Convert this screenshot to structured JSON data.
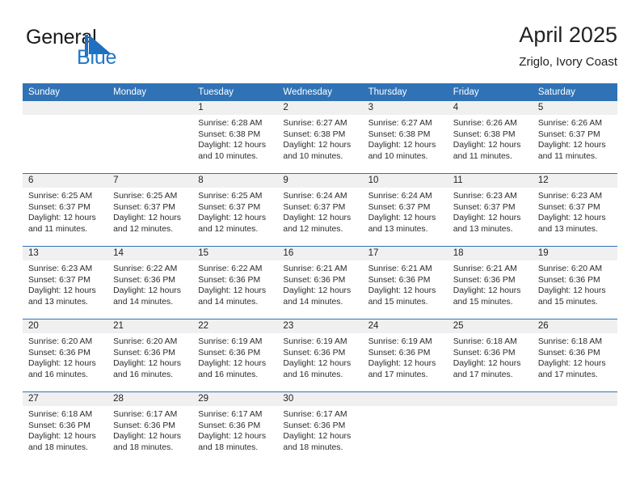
{
  "brand": {
    "name_top": "General",
    "name_bottom": "Blue",
    "flag_icon": "triangle-flag-icon",
    "color_top": "#1a1a1a",
    "color_bottom": "#2277c8"
  },
  "header": {
    "title": "April 2025",
    "subtitle": "Zriglo, Ivory Coast"
  },
  "theme": {
    "header_blue": "#3072b6",
    "daynum_band": "#f0f0f0",
    "text": "#222222"
  },
  "weekdays": [
    "Sunday",
    "Monday",
    "Tuesday",
    "Wednesday",
    "Thursday",
    "Friday",
    "Saturday"
  ],
  "labels": {
    "sunrise_prefix": "Sunrise: ",
    "sunset_prefix": "Sunset: ",
    "daylight_prefix": "Daylight: "
  },
  "weeks": [
    [
      {
        "day": "",
        "empty": true
      },
      {
        "day": "",
        "empty": true
      },
      {
        "day": "1",
        "sunrise": "Sunrise: 6:28 AM",
        "sunset": "Sunset: 6:38 PM",
        "daylight_l1": "Daylight: 12 hours",
        "daylight_l2": "and 10 minutes."
      },
      {
        "day": "2",
        "sunrise": "Sunrise: 6:27 AM",
        "sunset": "Sunset: 6:38 PM",
        "daylight_l1": "Daylight: 12 hours",
        "daylight_l2": "and 10 minutes."
      },
      {
        "day": "3",
        "sunrise": "Sunrise: 6:27 AM",
        "sunset": "Sunset: 6:38 PM",
        "daylight_l1": "Daylight: 12 hours",
        "daylight_l2": "and 10 minutes."
      },
      {
        "day": "4",
        "sunrise": "Sunrise: 6:26 AM",
        "sunset": "Sunset: 6:38 PM",
        "daylight_l1": "Daylight: 12 hours",
        "daylight_l2": "and 11 minutes."
      },
      {
        "day": "5",
        "sunrise": "Sunrise: 6:26 AM",
        "sunset": "Sunset: 6:37 PM",
        "daylight_l1": "Daylight: 12 hours",
        "daylight_l2": "and 11 minutes."
      }
    ],
    [
      {
        "day": "6",
        "sunrise": "Sunrise: 6:25 AM",
        "sunset": "Sunset: 6:37 PM",
        "daylight_l1": "Daylight: 12 hours",
        "daylight_l2": "and 11 minutes."
      },
      {
        "day": "7",
        "sunrise": "Sunrise: 6:25 AM",
        "sunset": "Sunset: 6:37 PM",
        "daylight_l1": "Daylight: 12 hours",
        "daylight_l2": "and 12 minutes."
      },
      {
        "day": "8",
        "sunrise": "Sunrise: 6:25 AM",
        "sunset": "Sunset: 6:37 PM",
        "daylight_l1": "Daylight: 12 hours",
        "daylight_l2": "and 12 minutes."
      },
      {
        "day": "9",
        "sunrise": "Sunrise: 6:24 AM",
        "sunset": "Sunset: 6:37 PM",
        "daylight_l1": "Daylight: 12 hours",
        "daylight_l2": "and 12 minutes."
      },
      {
        "day": "10",
        "sunrise": "Sunrise: 6:24 AM",
        "sunset": "Sunset: 6:37 PM",
        "daylight_l1": "Daylight: 12 hours",
        "daylight_l2": "and 13 minutes."
      },
      {
        "day": "11",
        "sunrise": "Sunrise: 6:23 AM",
        "sunset": "Sunset: 6:37 PM",
        "daylight_l1": "Daylight: 12 hours",
        "daylight_l2": "and 13 minutes."
      },
      {
        "day": "12",
        "sunrise": "Sunrise: 6:23 AM",
        "sunset": "Sunset: 6:37 PM",
        "daylight_l1": "Daylight: 12 hours",
        "daylight_l2": "and 13 minutes."
      }
    ],
    [
      {
        "day": "13",
        "sunrise": "Sunrise: 6:23 AM",
        "sunset": "Sunset: 6:37 PM",
        "daylight_l1": "Daylight: 12 hours",
        "daylight_l2": "and 13 minutes."
      },
      {
        "day": "14",
        "sunrise": "Sunrise: 6:22 AM",
        "sunset": "Sunset: 6:36 PM",
        "daylight_l1": "Daylight: 12 hours",
        "daylight_l2": "and 14 minutes."
      },
      {
        "day": "15",
        "sunrise": "Sunrise: 6:22 AM",
        "sunset": "Sunset: 6:36 PM",
        "daylight_l1": "Daylight: 12 hours",
        "daylight_l2": "and 14 minutes."
      },
      {
        "day": "16",
        "sunrise": "Sunrise: 6:21 AM",
        "sunset": "Sunset: 6:36 PM",
        "daylight_l1": "Daylight: 12 hours",
        "daylight_l2": "and 14 minutes."
      },
      {
        "day": "17",
        "sunrise": "Sunrise: 6:21 AM",
        "sunset": "Sunset: 6:36 PM",
        "daylight_l1": "Daylight: 12 hours",
        "daylight_l2": "and 15 minutes."
      },
      {
        "day": "18",
        "sunrise": "Sunrise: 6:21 AM",
        "sunset": "Sunset: 6:36 PM",
        "daylight_l1": "Daylight: 12 hours",
        "daylight_l2": "and 15 minutes."
      },
      {
        "day": "19",
        "sunrise": "Sunrise: 6:20 AM",
        "sunset": "Sunset: 6:36 PM",
        "daylight_l1": "Daylight: 12 hours",
        "daylight_l2": "and 15 minutes."
      }
    ],
    [
      {
        "day": "20",
        "sunrise": "Sunrise: 6:20 AM",
        "sunset": "Sunset: 6:36 PM",
        "daylight_l1": "Daylight: 12 hours",
        "daylight_l2": "and 16 minutes."
      },
      {
        "day": "21",
        "sunrise": "Sunrise: 6:20 AM",
        "sunset": "Sunset: 6:36 PM",
        "daylight_l1": "Daylight: 12 hours",
        "daylight_l2": "and 16 minutes."
      },
      {
        "day": "22",
        "sunrise": "Sunrise: 6:19 AM",
        "sunset": "Sunset: 6:36 PM",
        "daylight_l1": "Daylight: 12 hours",
        "daylight_l2": "and 16 minutes."
      },
      {
        "day": "23",
        "sunrise": "Sunrise: 6:19 AM",
        "sunset": "Sunset: 6:36 PM",
        "daylight_l1": "Daylight: 12 hours",
        "daylight_l2": "and 16 minutes."
      },
      {
        "day": "24",
        "sunrise": "Sunrise: 6:19 AM",
        "sunset": "Sunset: 6:36 PM",
        "daylight_l1": "Daylight: 12 hours",
        "daylight_l2": "and 17 minutes."
      },
      {
        "day": "25",
        "sunrise": "Sunrise: 6:18 AM",
        "sunset": "Sunset: 6:36 PM",
        "daylight_l1": "Daylight: 12 hours",
        "daylight_l2": "and 17 minutes."
      },
      {
        "day": "26",
        "sunrise": "Sunrise: 6:18 AM",
        "sunset": "Sunset: 6:36 PM",
        "daylight_l1": "Daylight: 12 hours",
        "daylight_l2": "and 17 minutes."
      }
    ],
    [
      {
        "day": "27",
        "sunrise": "Sunrise: 6:18 AM",
        "sunset": "Sunset: 6:36 PM",
        "daylight_l1": "Daylight: 12 hours",
        "daylight_l2": "and 18 minutes."
      },
      {
        "day": "28",
        "sunrise": "Sunrise: 6:17 AM",
        "sunset": "Sunset: 6:36 PM",
        "daylight_l1": "Daylight: 12 hours",
        "daylight_l2": "and 18 minutes."
      },
      {
        "day": "29",
        "sunrise": "Sunrise: 6:17 AM",
        "sunset": "Sunset: 6:36 PM",
        "daylight_l1": "Daylight: 12 hours",
        "daylight_l2": "and 18 minutes."
      },
      {
        "day": "30",
        "sunrise": "Sunrise: 6:17 AM",
        "sunset": "Sunset: 6:36 PM",
        "daylight_l1": "Daylight: 12 hours",
        "daylight_l2": "and 18 minutes."
      },
      {
        "day": "",
        "empty": true
      },
      {
        "day": "",
        "empty": true
      },
      {
        "day": "",
        "empty": true
      }
    ]
  ]
}
